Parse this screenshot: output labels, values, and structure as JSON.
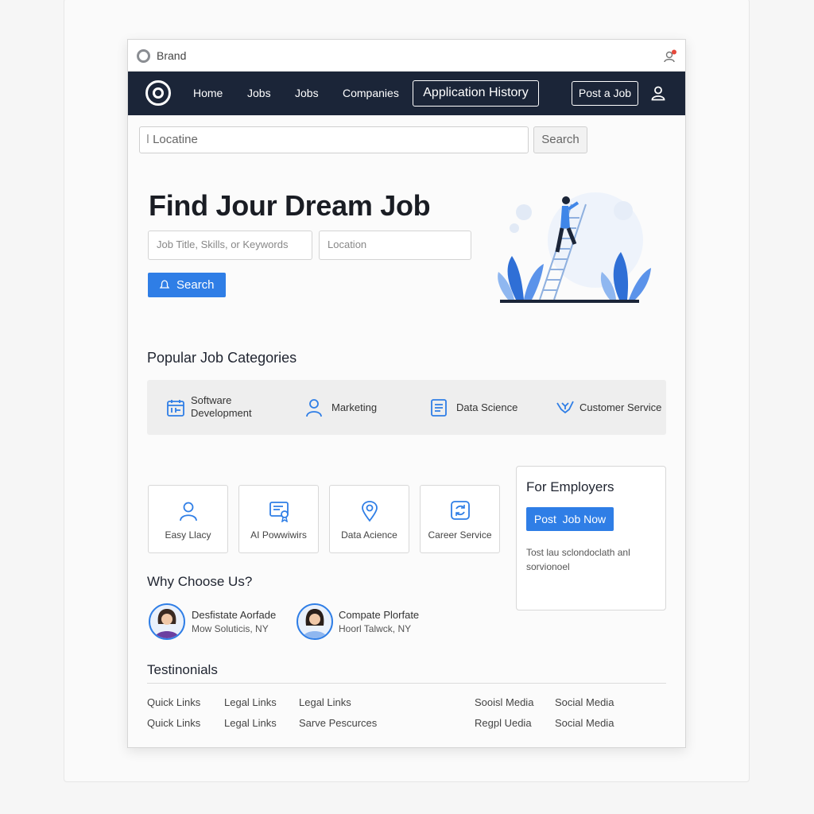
{
  "titlebar": {
    "brand": "Brand"
  },
  "nav": {
    "links": [
      "Home",
      "Jobs",
      "Jobs",
      "Companies"
    ],
    "active": "Application History",
    "post_job": "Post a Job"
  },
  "top_search": {
    "placeholder": "Locatine",
    "button": "Search"
  },
  "hero": {
    "title": "Find Jour Dream Job",
    "keywords_placeholder": "Job Title, Skills, or Keywords",
    "location_placeholder": "Location",
    "search_button": "Search"
  },
  "categories": {
    "title": "Popular Job Categories",
    "items": [
      {
        "label": "Software\nDevelopment",
        "icon": "grid-calendar-icon"
      },
      {
        "label": "Marketing",
        "icon": "person-icon"
      },
      {
        "label": "Data Science",
        "icon": "document-icon"
      },
      {
        "label": "Customer Service",
        "icon": "handshake-icon"
      }
    ]
  },
  "features": [
    {
      "label": "Easy Llacy",
      "icon": "person-icon"
    },
    {
      "label": "AI Powwiwirs",
      "icon": "certificate-icon"
    },
    {
      "label": "Data Acience",
      "icon": "location-pin-icon"
    },
    {
      "label": "Career Service",
      "icon": "refresh-icon"
    }
  ],
  "employers": {
    "title": "For Employers",
    "button": "Post  Job Now",
    "description": "Tost lau sclondoclath anl sorvionoel"
  },
  "why_choose": {
    "title": "Why Choose Us?",
    "people": [
      {
        "name": "Desfistate Aorfade",
        "location": "Mow Soluticis, NY"
      },
      {
        "name": "Compate Plorfate",
        "location": "Hoorl Talwck, NY"
      }
    ]
  },
  "testimonials": {
    "title": "Testinonials"
  },
  "footer": {
    "row1": [
      "Quick Links",
      "Legal Links",
      "Legal Links",
      "Sooisl Media",
      "Social Media"
    ],
    "row2": [
      "Quick Links",
      "Legal Links",
      "Sarve Pescurces",
      "Regpl Uedia",
      "Social Media"
    ]
  },
  "colors": {
    "navbar": "#1b2538",
    "accent": "#2f7ee6"
  }
}
